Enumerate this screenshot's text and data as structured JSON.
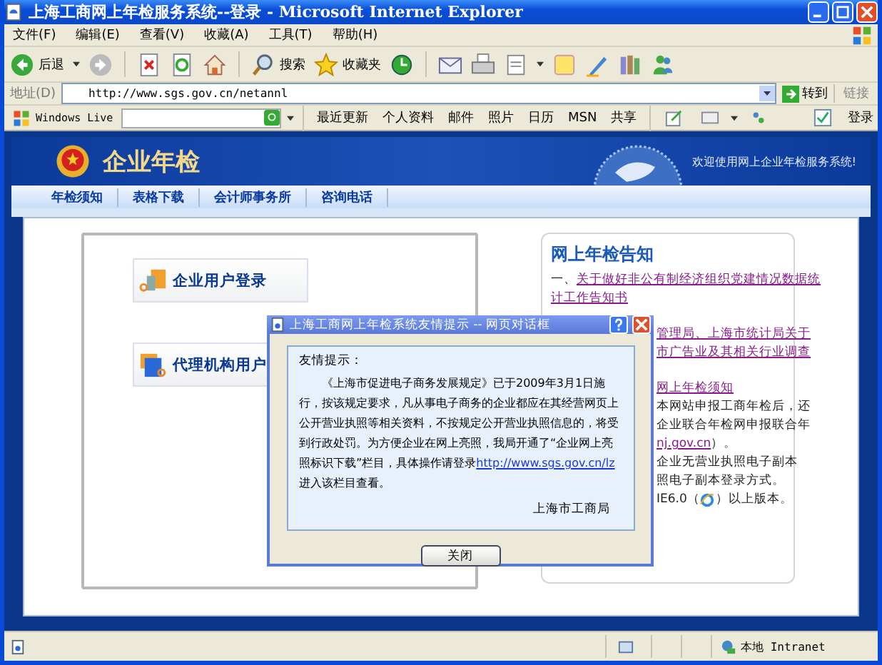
{
  "window": {
    "title": "上海工商网上年检服务系统--登录 - Microsoft Internet Explorer"
  },
  "menu": [
    "文件(F)",
    "编辑(E)",
    "查看(V)",
    "收藏(A)",
    "工具(T)",
    "帮助(H)"
  ],
  "toolbar": [
    {
      "kind": "back",
      "label": "后退"
    },
    {
      "kind": "forward"
    },
    {
      "kind": "stop"
    },
    {
      "kind": "refresh"
    },
    {
      "kind": "home"
    },
    {
      "kind": "search",
      "label": "搜索"
    },
    {
      "kind": "favorites",
      "label": "收藏夹"
    },
    {
      "kind": "history"
    },
    {
      "kind": "mail"
    },
    {
      "kind": "print"
    },
    {
      "kind": "edit"
    },
    {
      "kind": "note"
    },
    {
      "kind": "pen"
    },
    {
      "kind": "books"
    },
    {
      "kind": "messenger"
    }
  ],
  "address": {
    "label": "地址(D)",
    "value": "http://www.sgs.gov.cn/netannl",
    "go": "转到",
    "links": "链接"
  },
  "live_bar": {
    "brand": "Windows Live",
    "items": [
      "最近更新",
      "个人资料",
      "邮件",
      "照片",
      "日历",
      "MSN",
      "共享"
    ],
    "signin": "登录"
  },
  "site": {
    "title": "企业年检",
    "welcome": "欢迎使用网上企业年检服务系统!",
    "nav": [
      "年检须知",
      "表格下载",
      "会计师事务所",
      "咨询电话"
    ]
  },
  "login_buttons": [
    "企业用户登录",
    "代理机构用户"
  ],
  "notice": {
    "title": "网上年检告知",
    "paragraphs": [
      {
        "lines": [
          {
            "prefix": "一、",
            "text": "关于做好非公有制经济组织党建情况数据统",
            "kind": "link",
            "covered": false
          },
          {
            "text": "计工作告知书",
            "kind": "link",
            "covered": false
          }
        ]
      },
      {
        "lines": [
          {
            "text": "管理局、上海市统计局关于",
            "kind": "link",
            "covered": true
          },
          {
            "text": "市广告业及其相关行业调查",
            "kind": "link",
            "covered": true
          }
        ]
      },
      {
        "lines": [
          {
            "text": "网上年检须知",
            "kind": "link",
            "covered": true
          },
          {
            "text": "本网站申报工商年检后，还",
            "kind": "text",
            "covered": true
          },
          {
            "text": "企业联合年检网申报联合年",
            "kind": "text",
            "covered": true
          },
          {
            "text": "nj.gov.cn",
            "kind": "link",
            "suffix": "）。",
            "covered": true
          },
          {
            "text": "企业无营业执照电子副本",
            "kind": "text",
            "covered": true
          },
          {
            "text": "照电子副本登录方式。",
            "kind": "text",
            "covered": true
          },
          {
            "text": "IE6.0（",
            "kind": "text",
            "icon": true,
            "suffix": "）以上版本。",
            "covered": true
          }
        ]
      }
    ]
  },
  "dialog": {
    "title": "上海工商网上年检系统友情提示 -- 网页对话框",
    "heading": "友情提示：",
    "body": "《上海市促进电子商务发展规定》已于2009年3月1日施行，按该规定要求，凡从事电子商务的企业都应在其经营网页上公开营业执照等相关资料，不按规定公开营业执照信息的，将受到行政处罚。为方便企业在网上亮照，我局开通了“企业网上亮照标识下载”栏目，具体操作请登录",
    "link": "http://www.sgs.gov.cn/lz",
    "after": " 进入该栏目查看。",
    "signature": "上海市工商局",
    "button": "关闭"
  },
  "status_bar": {
    "zone": "本地 Intranet"
  }
}
